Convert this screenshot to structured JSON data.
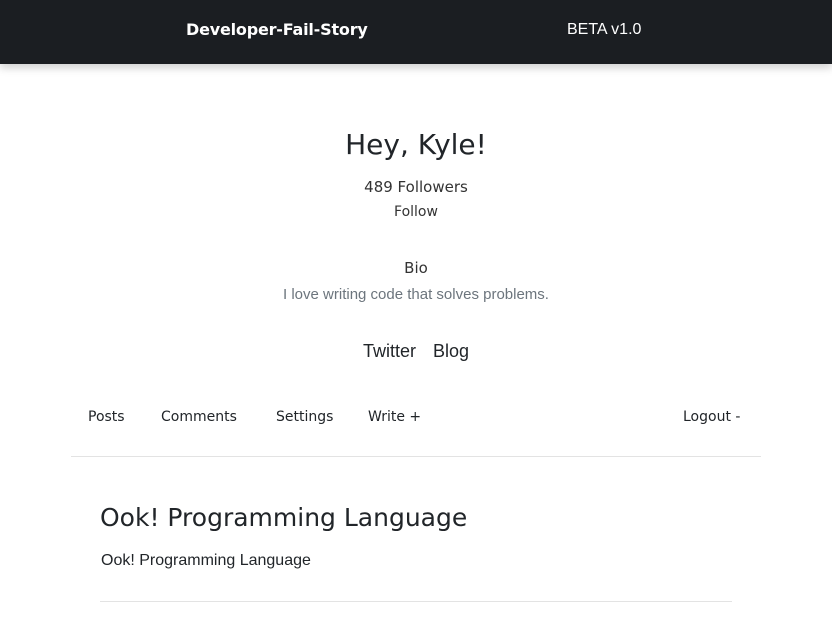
{
  "header": {
    "brand": "Developer-Fail-Story",
    "version": "BETA v1.0"
  },
  "profile": {
    "greeting": "Hey, Kyle!",
    "followers": "489 Followers",
    "follow_label": "Follow",
    "bio_label": "Bio",
    "bio_text": "I love writing code that solves problems.",
    "links": [
      "Twitter",
      "Blog"
    ]
  },
  "tabs": {
    "posts": "Posts",
    "comments": "Comments",
    "settings": "Settings",
    "write": "Write +",
    "logout": "Logout -"
  },
  "posts": [
    {
      "title": "Ook! Programming Language",
      "excerpt": "Ook! Programming Language"
    }
  ]
}
